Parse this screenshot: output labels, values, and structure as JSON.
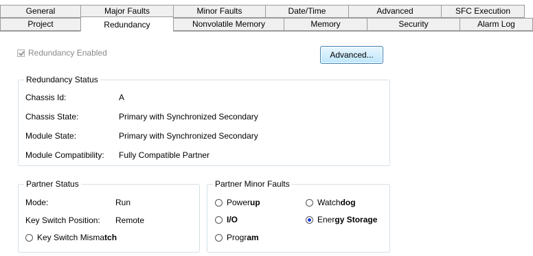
{
  "tabs_top": [
    "General",
    "Major Faults",
    "Minor Faults",
    "Date/Time",
    "Advanced",
    "SFC Execution"
  ],
  "tabs_bottom": [
    "Project",
    "Redundancy",
    "Nonvolatile Memory",
    "Memory",
    "Security",
    "Alarm Log"
  ],
  "active_tab": "Redundancy",
  "redundancy_enabled": {
    "label": "Redundancy Enabled",
    "checked": true,
    "disabled": true
  },
  "advanced_button": "Advanced...",
  "redundancy_status": {
    "title": "Redundancy Status",
    "chassis_id_label": "Chassis Id:",
    "chassis_id_value": "A",
    "chassis_state_label": "Chassis State:",
    "chassis_state_value": "Primary with Synchronized Secondary",
    "module_state_label": "Module State:",
    "module_state_value": "Primary with Synchronized Secondary",
    "module_compat_label": "Module Compatibility:",
    "module_compat_value": "Fully Compatible Partner"
  },
  "partner_status": {
    "title": "Partner Status",
    "mode_label": "Mode:",
    "mode_value": "Run",
    "key_switch_label": "Key Switch Position:",
    "key_switch_value": "Remote",
    "mismatch_prefix": "Key Switch Misma",
    "mismatch_suffix": "tch",
    "mismatch_active": false
  },
  "partner_minor_faults": {
    "title": "Partner Minor Faults",
    "powerup": {
      "prefix": "Power",
      "suffix": "up",
      "active": false
    },
    "io": {
      "prefix": "",
      "suffix": "I/O",
      "active": false
    },
    "program": {
      "prefix": "Progr",
      "suffix": "am",
      "active": false
    },
    "watchdog": {
      "prefix": "Watch",
      "suffix": "dog",
      "active": false
    },
    "energy_storage": {
      "prefix": "Ener",
      "suffix": "gy Storage",
      "active": true
    }
  }
}
